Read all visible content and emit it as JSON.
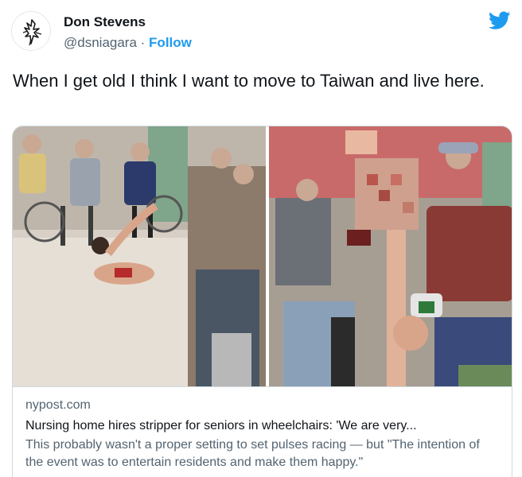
{
  "author": {
    "name": "Don Stevens",
    "handle": "@dsniagara",
    "separator": " · ",
    "follow_label": "Follow"
  },
  "tweet": {
    "text": "When I get old I think I want to move to Taiwan and live here."
  },
  "link_card": {
    "domain": "nypost.com",
    "title": "Nursing home hires stripper for seniors in wheelchairs: 'We are very...",
    "description": "This probably wasn't a proper setting to set pulses racing — but \"The intention of the event was to entertain residents and make them happy.\""
  },
  "icons": {
    "brand": "twitter-bird-icon",
    "avatar": "lightning-sketch-avatar"
  },
  "colors": {
    "accent": "#1d9bf0",
    "text_primary": "#0f1419",
    "text_secondary": "#536471",
    "border": "#cfd9de"
  }
}
